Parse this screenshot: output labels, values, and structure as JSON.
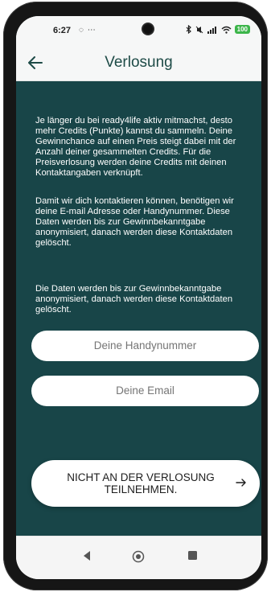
{
  "status_bar": {
    "time": "6:27",
    "left_icons": "◌ ⋯",
    "battery": "100"
  },
  "header": {
    "title": "Verlosung",
    "back_icon": "arrow-left-icon"
  },
  "content": {
    "paragraph_1": "Je länger du bei ready4life aktiv mitmachst, desto mehr Credits (Punkte) kannst du sammeln. Deine Gewinnchance auf einen Preis steigt dabei mit der Anzahl deiner gesammelten Credits. Für die Preisverlosung werden deine Credits mit deinen Kontaktangaben verknüpft.",
    "paragraph_2": "Damit wir dich kontaktieren können, benötigen wir deine E-mail Adresse oder Handynummer. Diese Daten werden bis zur Gewinnbekanntgabe anonymisiert, danach werden diese Kontaktdaten gelöscht.",
    "paragraph_3": "Die Daten werden bis zur Gewinnbekanntgabe anonymisiert, danach werden diese Kontaktdaten gelöscht."
  },
  "form": {
    "phone_placeholder": "Deine Handynummer",
    "email_placeholder": "Deine Email"
  },
  "action": {
    "label": "NICHT AN DER VERLOSUNG TEILNEHMEN.",
    "icon": "arrow-right-icon"
  },
  "colors": {
    "background": "#184548",
    "title": "#1e4b47",
    "surface": "#ffffff"
  }
}
